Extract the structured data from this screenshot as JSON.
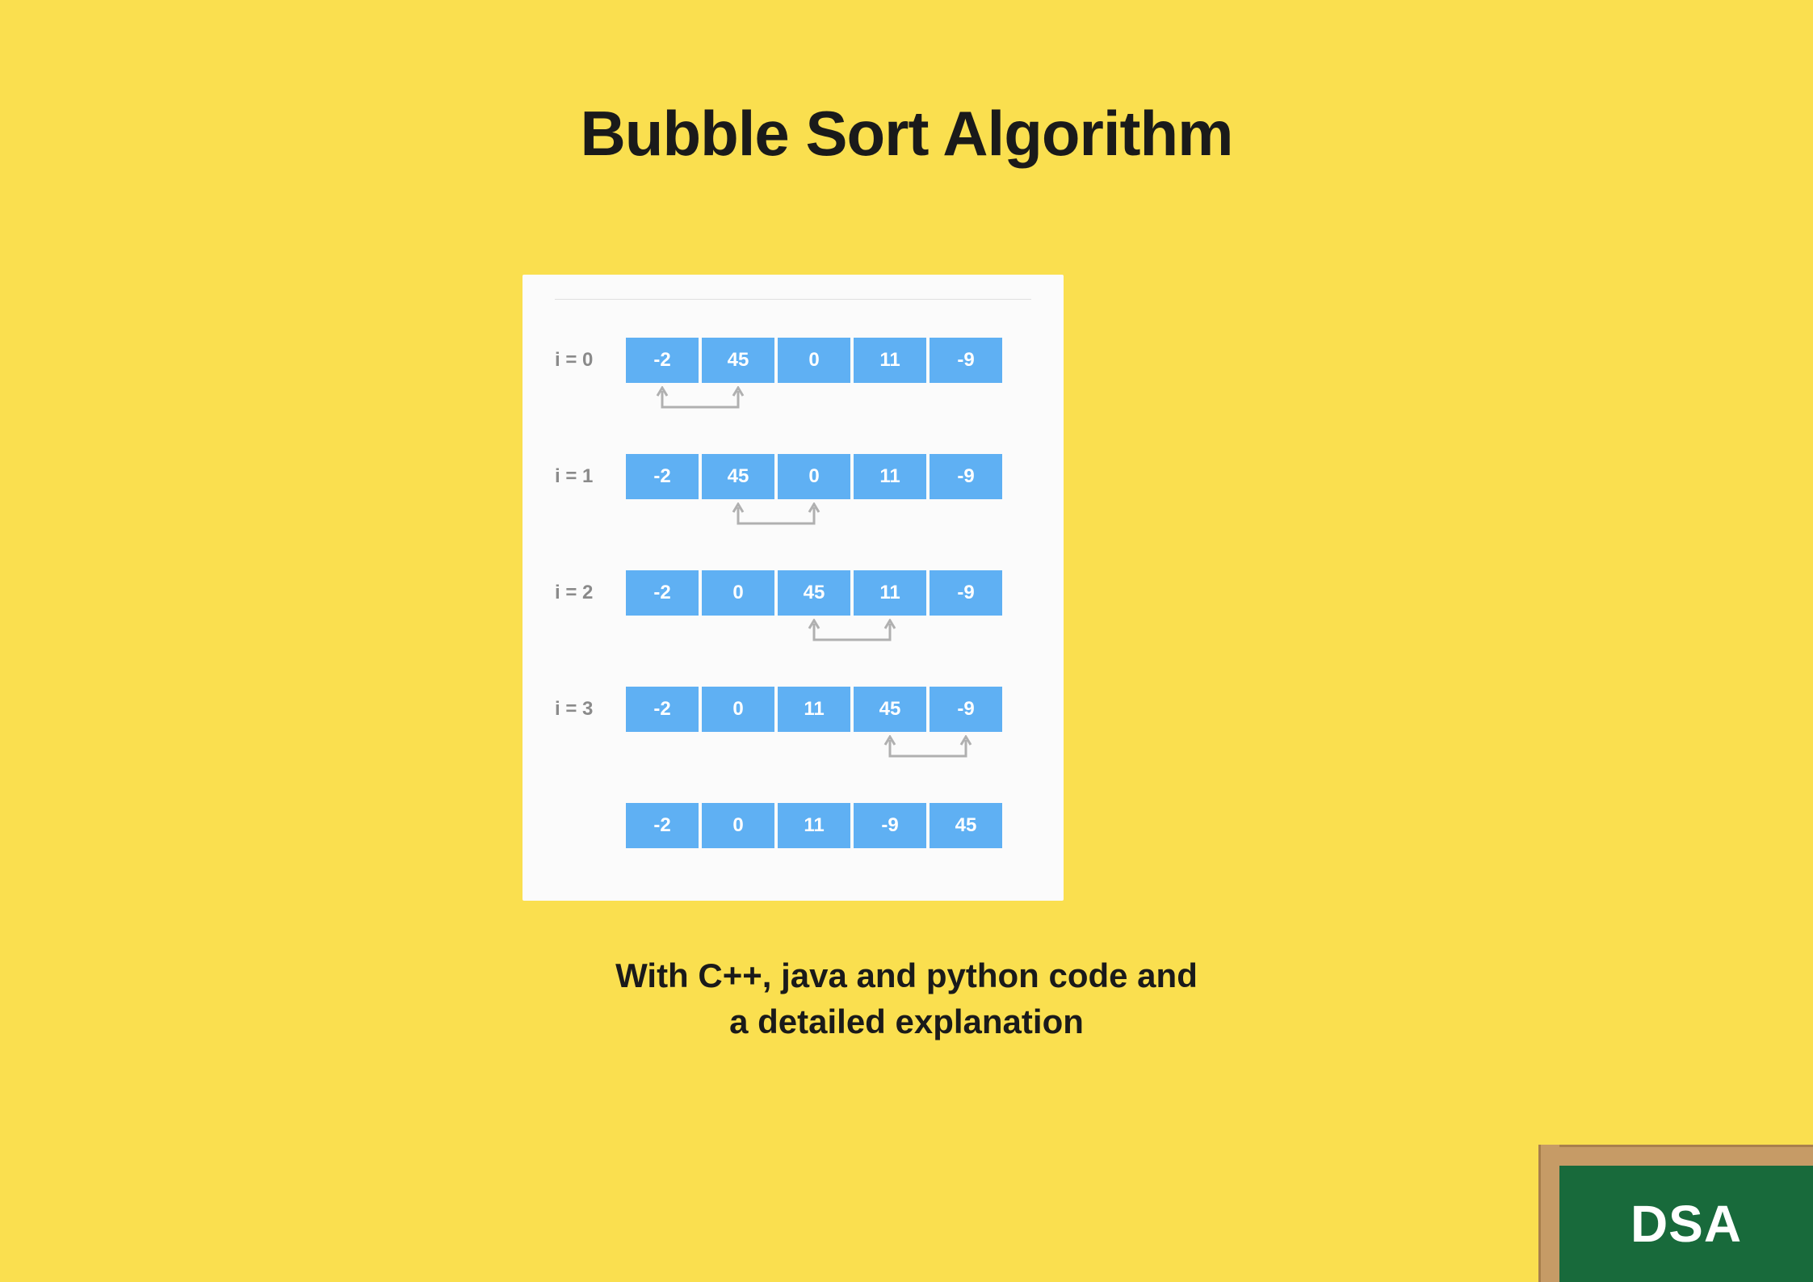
{
  "title": "Bubble Sort Algorithm",
  "subtitle_line1": "With C++, java and python  code and",
  "subtitle_line2": "a detailed explanation",
  "badge": "DSA",
  "steps": [
    {
      "label": "i = 0",
      "cells": [
        "-2",
        "45",
        "0",
        "11",
        "-9"
      ],
      "swap": [
        0,
        1
      ]
    },
    {
      "label": "i = 1",
      "cells": [
        "-2",
        "45",
        "0",
        "11",
        "-9"
      ],
      "swap": [
        1,
        2
      ]
    },
    {
      "label": "i = 2",
      "cells": [
        "-2",
        "0",
        "45",
        "11",
        "-9"
      ],
      "swap": [
        2,
        3
      ]
    },
    {
      "label": "i = 3",
      "cells": [
        "-2",
        "0",
        "11",
        "45",
        "-9"
      ],
      "swap": [
        3,
        4
      ]
    },
    {
      "label": "",
      "cells": [
        "-2",
        "0",
        "11",
        "-9",
        "45"
      ],
      "swap": null
    }
  ],
  "colors": {
    "bg": "#fadf4f",
    "cell": "#5fb0f3",
    "arrow": "#b0b0b0",
    "board_frame": "#c69b66",
    "board_green": "#186a3b"
  }
}
